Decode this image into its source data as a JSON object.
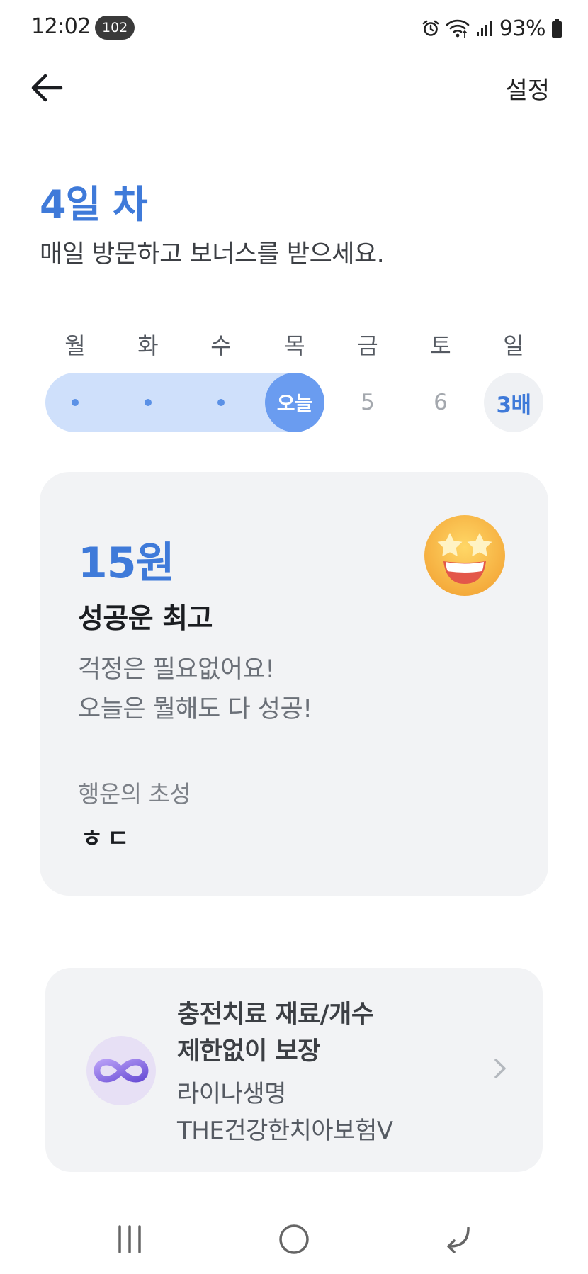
{
  "status_bar": {
    "time": "12:02",
    "notification_count": "102",
    "battery": "93%"
  },
  "header": {
    "settings_label": "설정"
  },
  "attendance": {
    "day_title": "4일 차",
    "subtitle": "매일 방문하고 보너스를 받으세요.",
    "weekdays": [
      "월",
      "화",
      "수",
      "목",
      "금",
      "토",
      "일"
    ],
    "days": [
      {
        "state": "done"
      },
      {
        "state": "done"
      },
      {
        "state": "done"
      },
      {
        "state": "today",
        "label": "오늘"
      },
      {
        "state": "future",
        "label": "5"
      },
      {
        "state": "future",
        "label": "6"
      },
      {
        "state": "bonus",
        "label": "3배"
      }
    ],
    "colors": {
      "accent": "#3f7ad9",
      "track": "#cfe0fb",
      "today": "#6a9cf0"
    }
  },
  "fortune": {
    "amount": "15원",
    "title": "성공운 최고",
    "lines": [
      "걱정은 필요없어요!",
      "오늘은 뭘해도 다 성공!"
    ],
    "lucky_label": "행운의 초성",
    "lucky_value": "ㅎㄷ",
    "emoji": "star-struck-emoji-icon"
  },
  "ad": {
    "headline": [
      "충전치료 재료/개수",
      "제한없이 보장"
    ],
    "body": [
      "라이나생명",
      "THE건강한치아보험V"
    ],
    "logo": "infinity-icon"
  },
  "nav": {
    "buttons": [
      "recents-icon",
      "home-icon",
      "back-icon"
    ]
  }
}
